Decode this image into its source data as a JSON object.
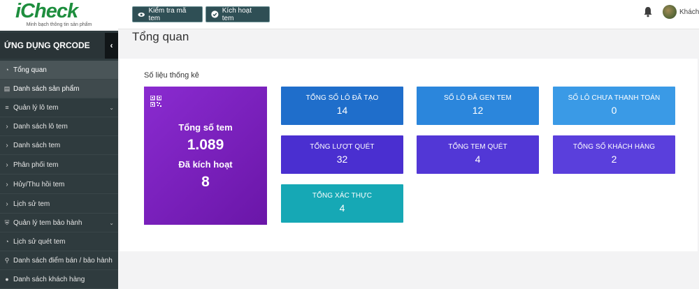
{
  "logo": {
    "text": "iCheck",
    "tagline": "Minh bạch thông tin sản phẩm"
  },
  "sidebar": {
    "app_title": "ỨNG DỤNG QRCODE",
    "collapse_glyph": "‹",
    "items": [
      {
        "label": "Tổng quan",
        "icon": "dashboard-icon"
      },
      {
        "label": "Danh sách sản phẩm",
        "icon": "barcode-icon"
      },
      {
        "label": "Quản lý lô tem",
        "icon": "list-icon"
      },
      {
        "label": "Danh sách lô tem",
        "icon": "chevron-right-icon"
      },
      {
        "label": "Danh sách tem",
        "icon": "chevron-right-icon"
      },
      {
        "label": "Phân phối tem",
        "icon": "chevron-right-icon"
      },
      {
        "label": "Hủy/Thu hồi tem",
        "icon": "chevron-right-icon"
      },
      {
        "label": "Lịch sử tem",
        "icon": "chevron-right-icon"
      },
      {
        "label": "Quản lý tem bảo hành",
        "icon": "shield-icon"
      },
      {
        "label": "Lịch sử quét tem",
        "icon": "history-icon"
      },
      {
        "label": "Danh sách điểm bán / bảo hành",
        "icon": "map-marker-icon"
      },
      {
        "label": "Danh sách khách hàng",
        "icon": "users-icon"
      }
    ]
  },
  "topbar": {
    "check_button": "Kiểm tra mã tem",
    "activate_button": "Kích hoạt tem",
    "user_name": "Khách"
  },
  "page": {
    "title": "Tổng quan"
  },
  "stats": {
    "section_title": "Số liệu thống kê",
    "big": {
      "label1": "Tổng số tem",
      "value1": "1.089",
      "label2": "Đã kích hoạt",
      "value2": "8"
    },
    "cards": [
      {
        "label": "TỔNG SỐ LÔ ĐÃ TẠO",
        "value": "14"
      },
      {
        "label": "SỐ LÔ ĐÃ GEN TEM",
        "value": "12"
      },
      {
        "label": "SỐ LÔ CHƯA THANH TOÁN",
        "value": "0"
      },
      {
        "label": "TỔNG LƯỢT QUÉT",
        "value": "32"
      },
      {
        "label": "TỔNG TEM QUÉT",
        "value": "4"
      },
      {
        "label": "TỔNG SỐ KHÁCH HÀNG",
        "value": "2"
      },
      {
        "label": "TỔNG XÁC THỰC",
        "value": "4"
      }
    ]
  },
  "colors": {
    "sidebar_bg": "#2f3b3e",
    "big_card": "#7b1fb6",
    "card_blue_dark": "#1f6ecb",
    "card_blue": "#2b86dc",
    "card_blue_light": "#3a9ae6",
    "card_purple": "#5a35d6",
    "card_teal": "#16a8b5"
  }
}
